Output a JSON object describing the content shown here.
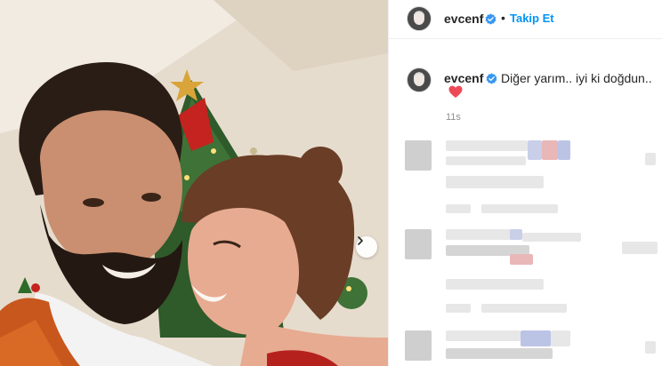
{
  "post": {
    "username": "evcenf",
    "verified_icon": "verified-badge-icon",
    "separator": "•",
    "follow_label": "Takip Et",
    "caption": "Diğer yarım.. iyi ki doğdun..",
    "caption_emoji": "heart-icon",
    "age": "11s",
    "accent_color": "#0095f6",
    "heart_color": "#ed4956"
  }
}
